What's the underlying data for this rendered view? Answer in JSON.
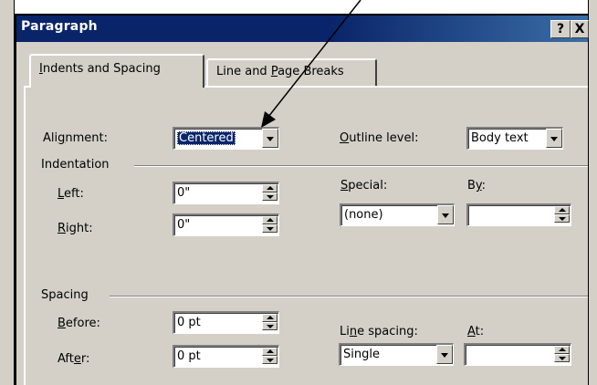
{
  "dialog": {
    "title": "Paragraph",
    "help_button": "?",
    "close_button": "X"
  },
  "tabs": [
    {
      "pre": "",
      "key": "I",
      "post": "ndents and Spacing",
      "selected": true
    },
    {
      "pre": "Line and ",
      "key": "P",
      "post": "age Breaks",
      "selected": false
    }
  ],
  "alignment": {
    "pre": "Ali",
    "key": "g",
    "post": "nment:",
    "value": "Centered"
  },
  "outline_level": {
    "pre": "",
    "key": "O",
    "post": "utline level:",
    "value": "Body text"
  },
  "indentation": {
    "heading": "Indentation",
    "left": {
      "pre": "",
      "key": "L",
      "post": "eft:",
      "value": "0\""
    },
    "right": {
      "pre": "",
      "key": "R",
      "post": "ight:",
      "value": "0\""
    },
    "special": {
      "pre": "",
      "key": "S",
      "post": "pecial:",
      "value": "(none)"
    },
    "by": {
      "pre": "B",
      "key": "y",
      "post": ":",
      "value": ""
    }
  },
  "spacing": {
    "heading": "Spacing",
    "before": {
      "pre": "",
      "key": "B",
      "post": "efore:",
      "value": "0 pt"
    },
    "after": {
      "pre": "Aft",
      "key": "e",
      "post": "r:",
      "value": "0 pt"
    },
    "line_spacing": {
      "pre": "Li",
      "key": "n",
      "post": "e spacing:",
      "value": "Single"
    },
    "at": {
      "pre": "",
      "key": "A",
      "post": "t:",
      "value": ""
    }
  },
  "colors": {
    "dialog_face": "#d4d0c8",
    "title_bar": "#0a246a",
    "selection": "#0a246a"
  }
}
